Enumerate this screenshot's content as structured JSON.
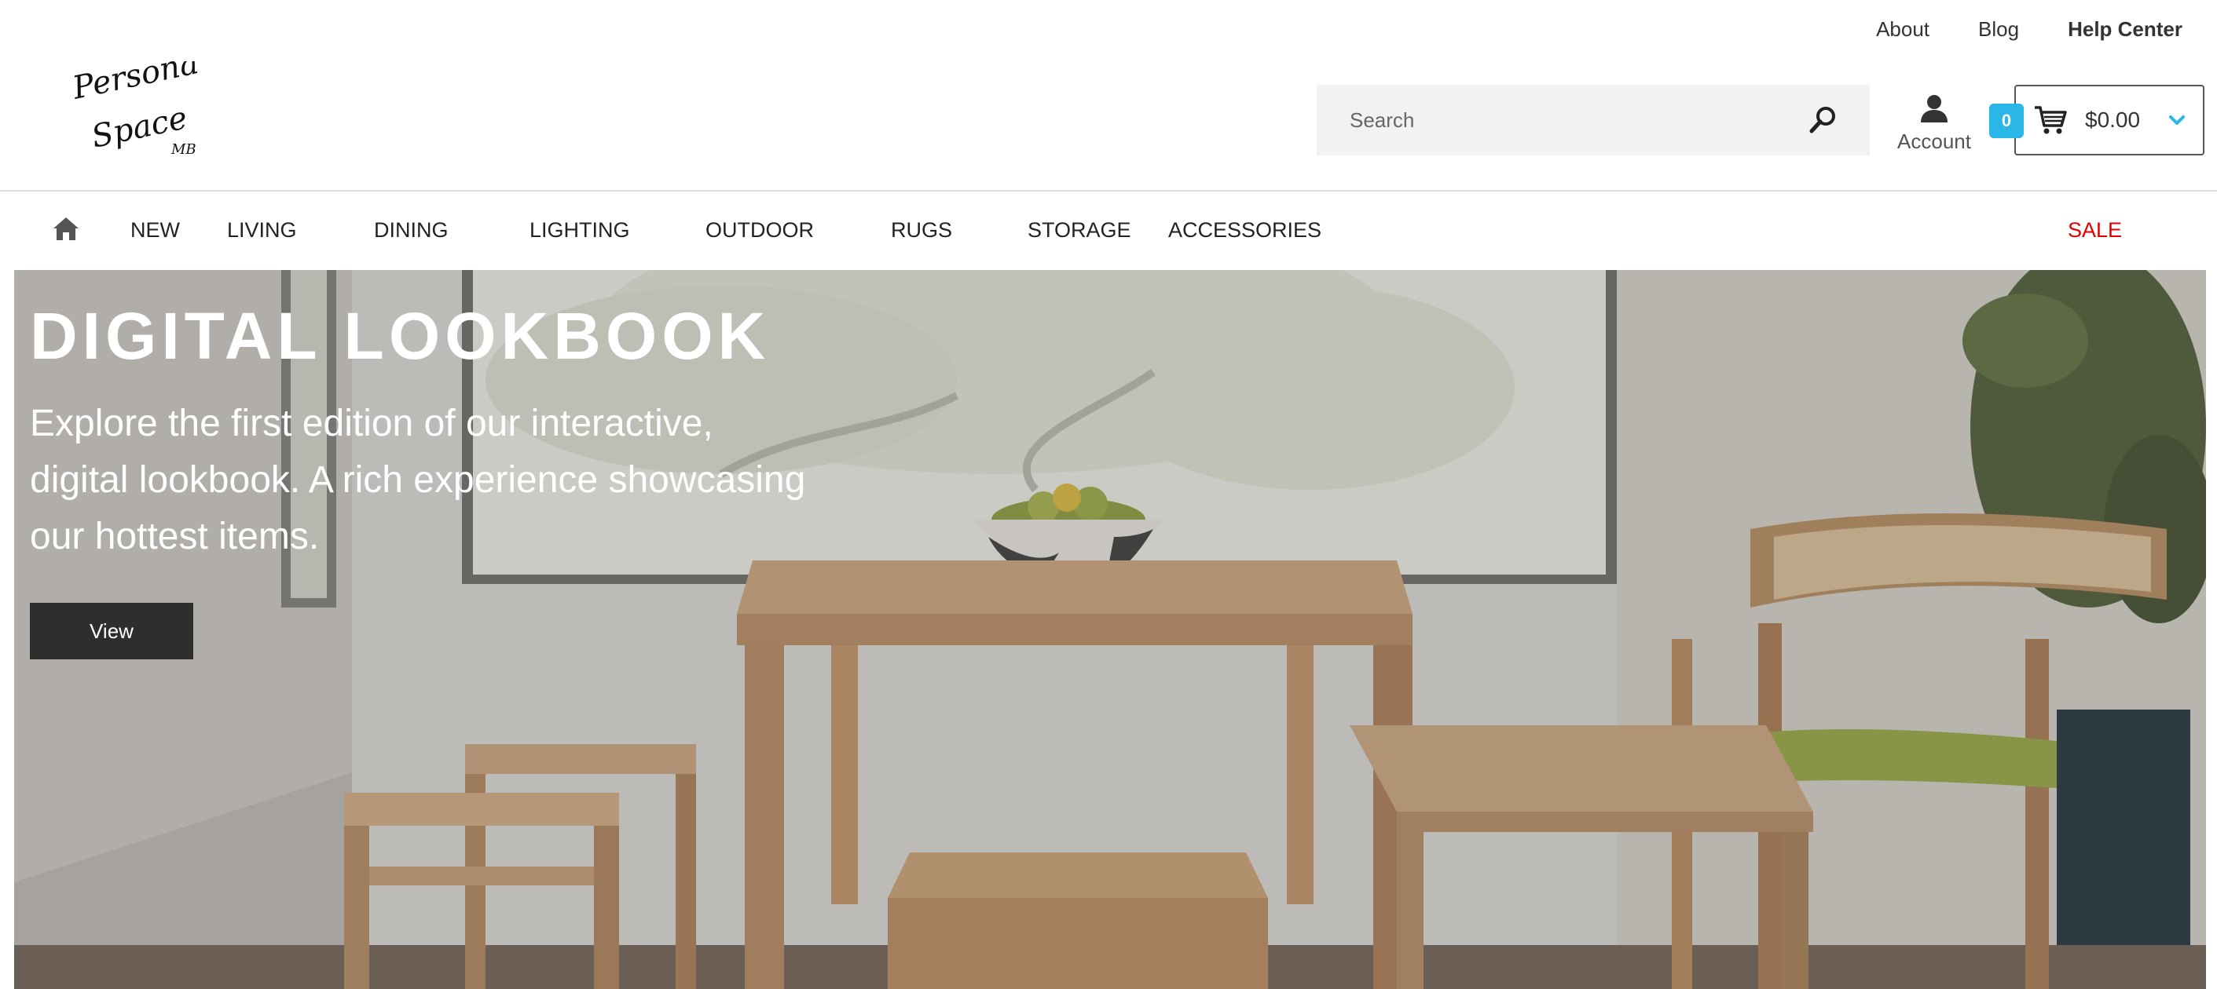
{
  "top_links": {
    "about": "About",
    "blog": "Blog",
    "help": "Help Center"
  },
  "logo": {
    "line1": "Personal",
    "line2": "Space",
    "mark": "MB"
  },
  "search": {
    "placeholder": "Search",
    "icon": "search-icon"
  },
  "account": {
    "label": "Account",
    "icon": "user-icon"
  },
  "cart": {
    "count": "0",
    "total": "$0.00",
    "icon": "cart-icon",
    "chevron": "chevron-down-icon",
    "accent": "#28b7e6"
  },
  "nav": {
    "home_icon": "home-icon",
    "items": [
      "NEW",
      "LIVING",
      "DINING",
      "LIGHTING",
      "OUTDOOR",
      "RUGS",
      "STORAGE",
      "ACCESSORIES"
    ],
    "sale": "SALE",
    "sale_color": "#e00000"
  },
  "hero": {
    "title": "DIGITAL LOOKBOOK",
    "subtitle": "Explore the first edition of our interactive, digital lookbook. A rich experience showcasing our hottest items.",
    "button": "View"
  }
}
